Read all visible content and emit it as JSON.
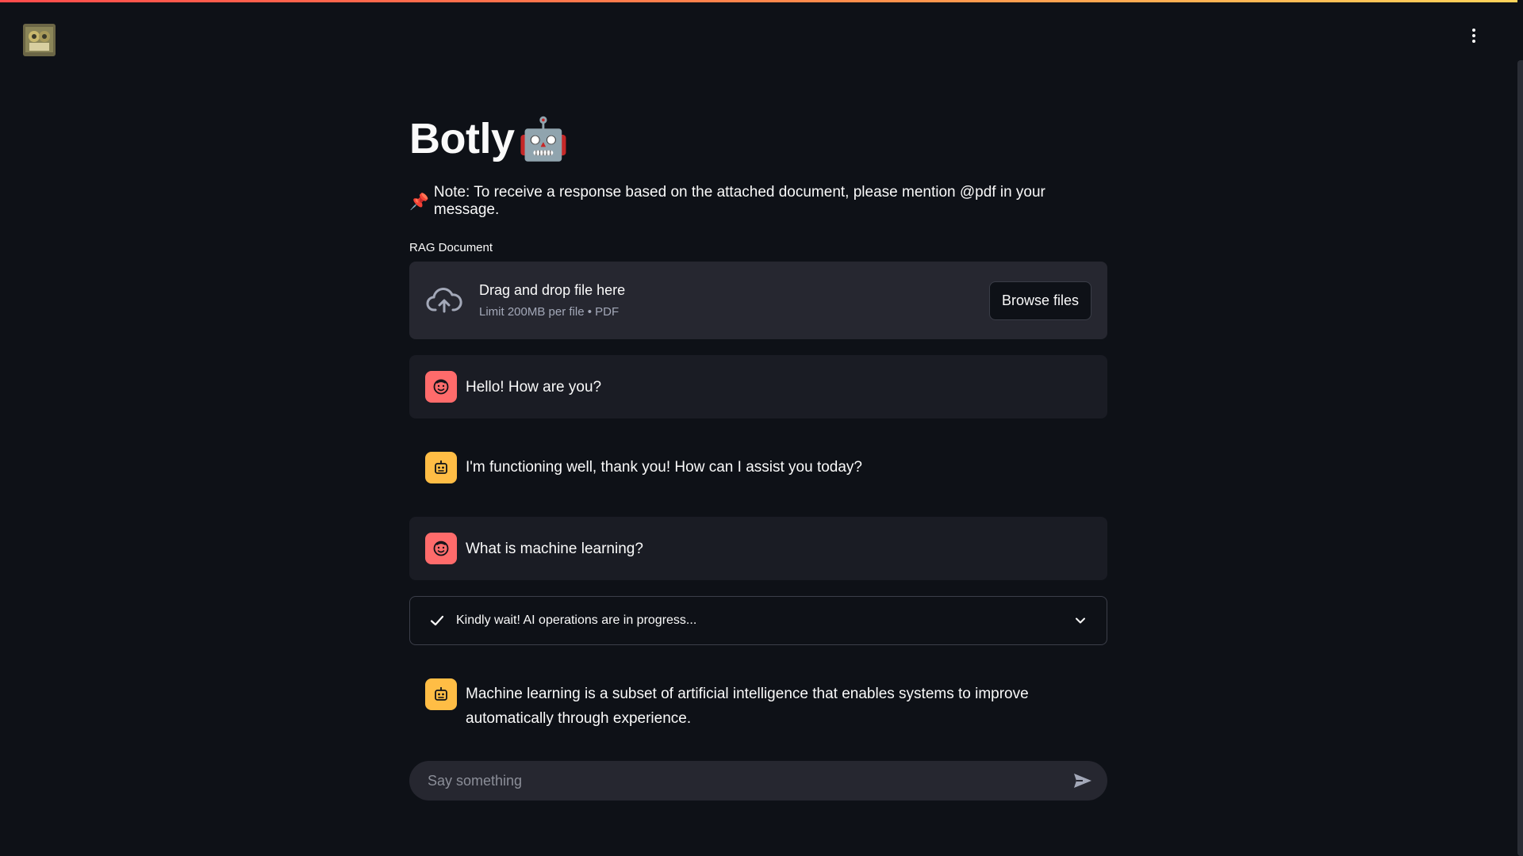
{
  "header": {
    "logo_icon": "app-logo-image",
    "menu_icon": "kebab-menu-icon"
  },
  "page": {
    "title": "Botly",
    "title_emoji": "🤖",
    "note_icon": "📌",
    "note": "Note: To receive a response based on the attached document, please mention @pdf in your message."
  },
  "uploader": {
    "label": "RAG Document",
    "drop_text": "Drag and drop file here",
    "limit_text": "Limit 200MB per file • PDF",
    "browse_label": "Browse files"
  },
  "messages": [
    {
      "role": "user",
      "text": "Hello! How are you?"
    },
    {
      "role": "assistant",
      "text": "I'm functioning well, thank you! How can I assist you today?"
    },
    {
      "role": "user",
      "text": "What is machine learning?"
    },
    {
      "role": "assistant",
      "text": "Machine learning is a subset of artificial intelligence that enables systems to improve automatically through experience."
    }
  ],
  "status": {
    "text": "Kindly wait! AI operations are in progress..."
  },
  "chat_input": {
    "placeholder": "Say something"
  },
  "colors": {
    "background": "#0e1117",
    "user_avatar": "#ff6b6b",
    "assistant_avatar": "#ffbd45",
    "surface": "#262730"
  }
}
